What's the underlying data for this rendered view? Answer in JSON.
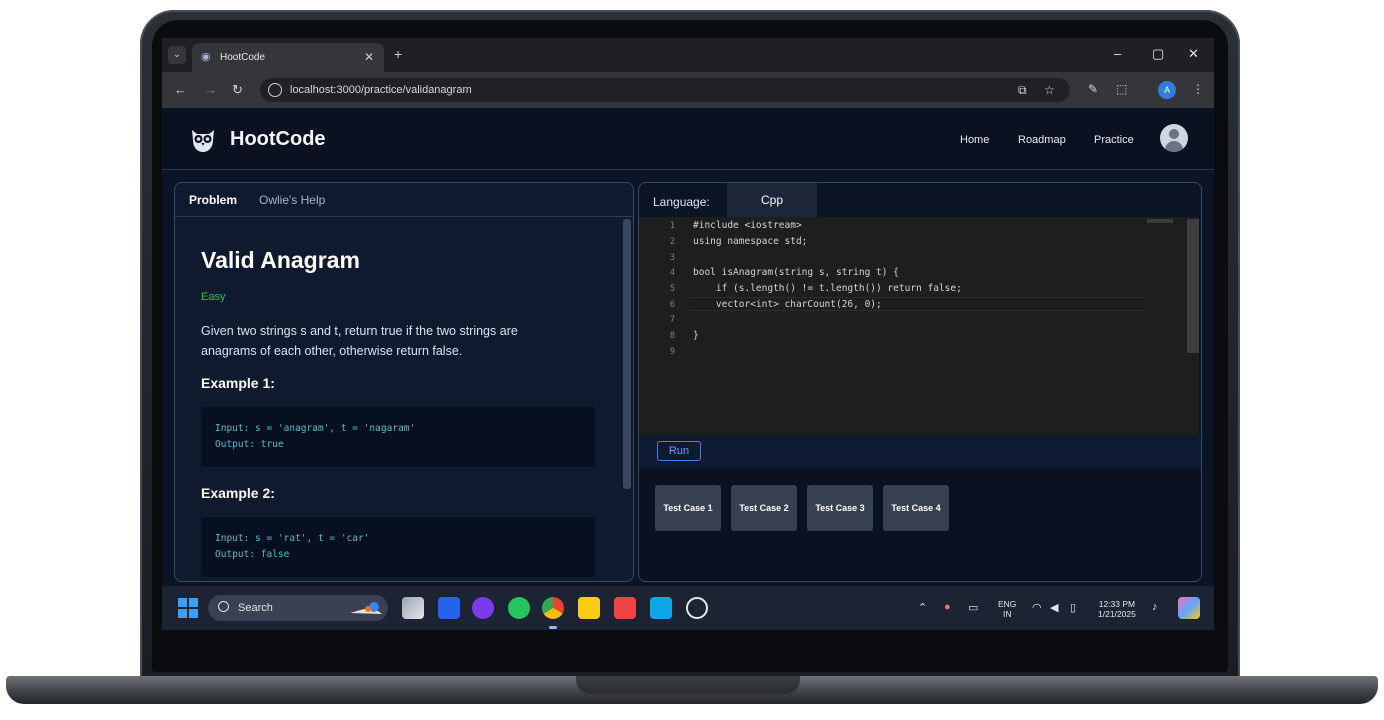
{
  "browser": {
    "tab_title": "HootCode",
    "url": "localhost:3000/practice/validanagram",
    "window_controls": [
      "–",
      "▢",
      "✕"
    ]
  },
  "app": {
    "brand": "HootCode",
    "nav": [
      "Home",
      "Roadmap",
      "Practice"
    ]
  },
  "problem_panel": {
    "tabs": [
      "Problem",
      "Owlie's Help"
    ],
    "title": "Valid Anagram",
    "difficulty": "Easy",
    "description": "Given two strings s and t, return true if the two strings are anagrams of each other, otherwise return false.",
    "examples": [
      {
        "heading": "Example 1:",
        "input": "Input: s = 'anagram', t = 'nagaram'",
        "output": "Output: true"
      },
      {
        "heading": "Example 2:",
        "input": "Input: s = 'rat', t = 'car'",
        "output": "Output: false"
      }
    ]
  },
  "editor_panel": {
    "language_label": "Language:",
    "language_value": "Cpp",
    "line_numbers": [
      "1",
      "2",
      "3",
      "4",
      "5",
      "6",
      "7",
      "8",
      "9"
    ],
    "code_lines": [
      "#include <iostream>",
      "using namespace std;",
      "",
      "bool isAnagram(string s, string t) {",
      "    if (s.length() != t.length()) return false;",
      "    vector<int> charCount(26, 0);",
      "",
      "}",
      ""
    ],
    "run_label": "Run",
    "test_cases": [
      "Test Case 1",
      "Test Case 2",
      "Test Case 3",
      "Test Case 4"
    ]
  },
  "taskbar": {
    "search_placeholder": "Search",
    "language": "ENG",
    "region": "IN",
    "time": "12:33 PM",
    "date": "1/21/2025"
  },
  "colors": {
    "difficulty_easy": "#22c55e",
    "accent_blue": "#3b82f6",
    "background": "#0c1525"
  }
}
